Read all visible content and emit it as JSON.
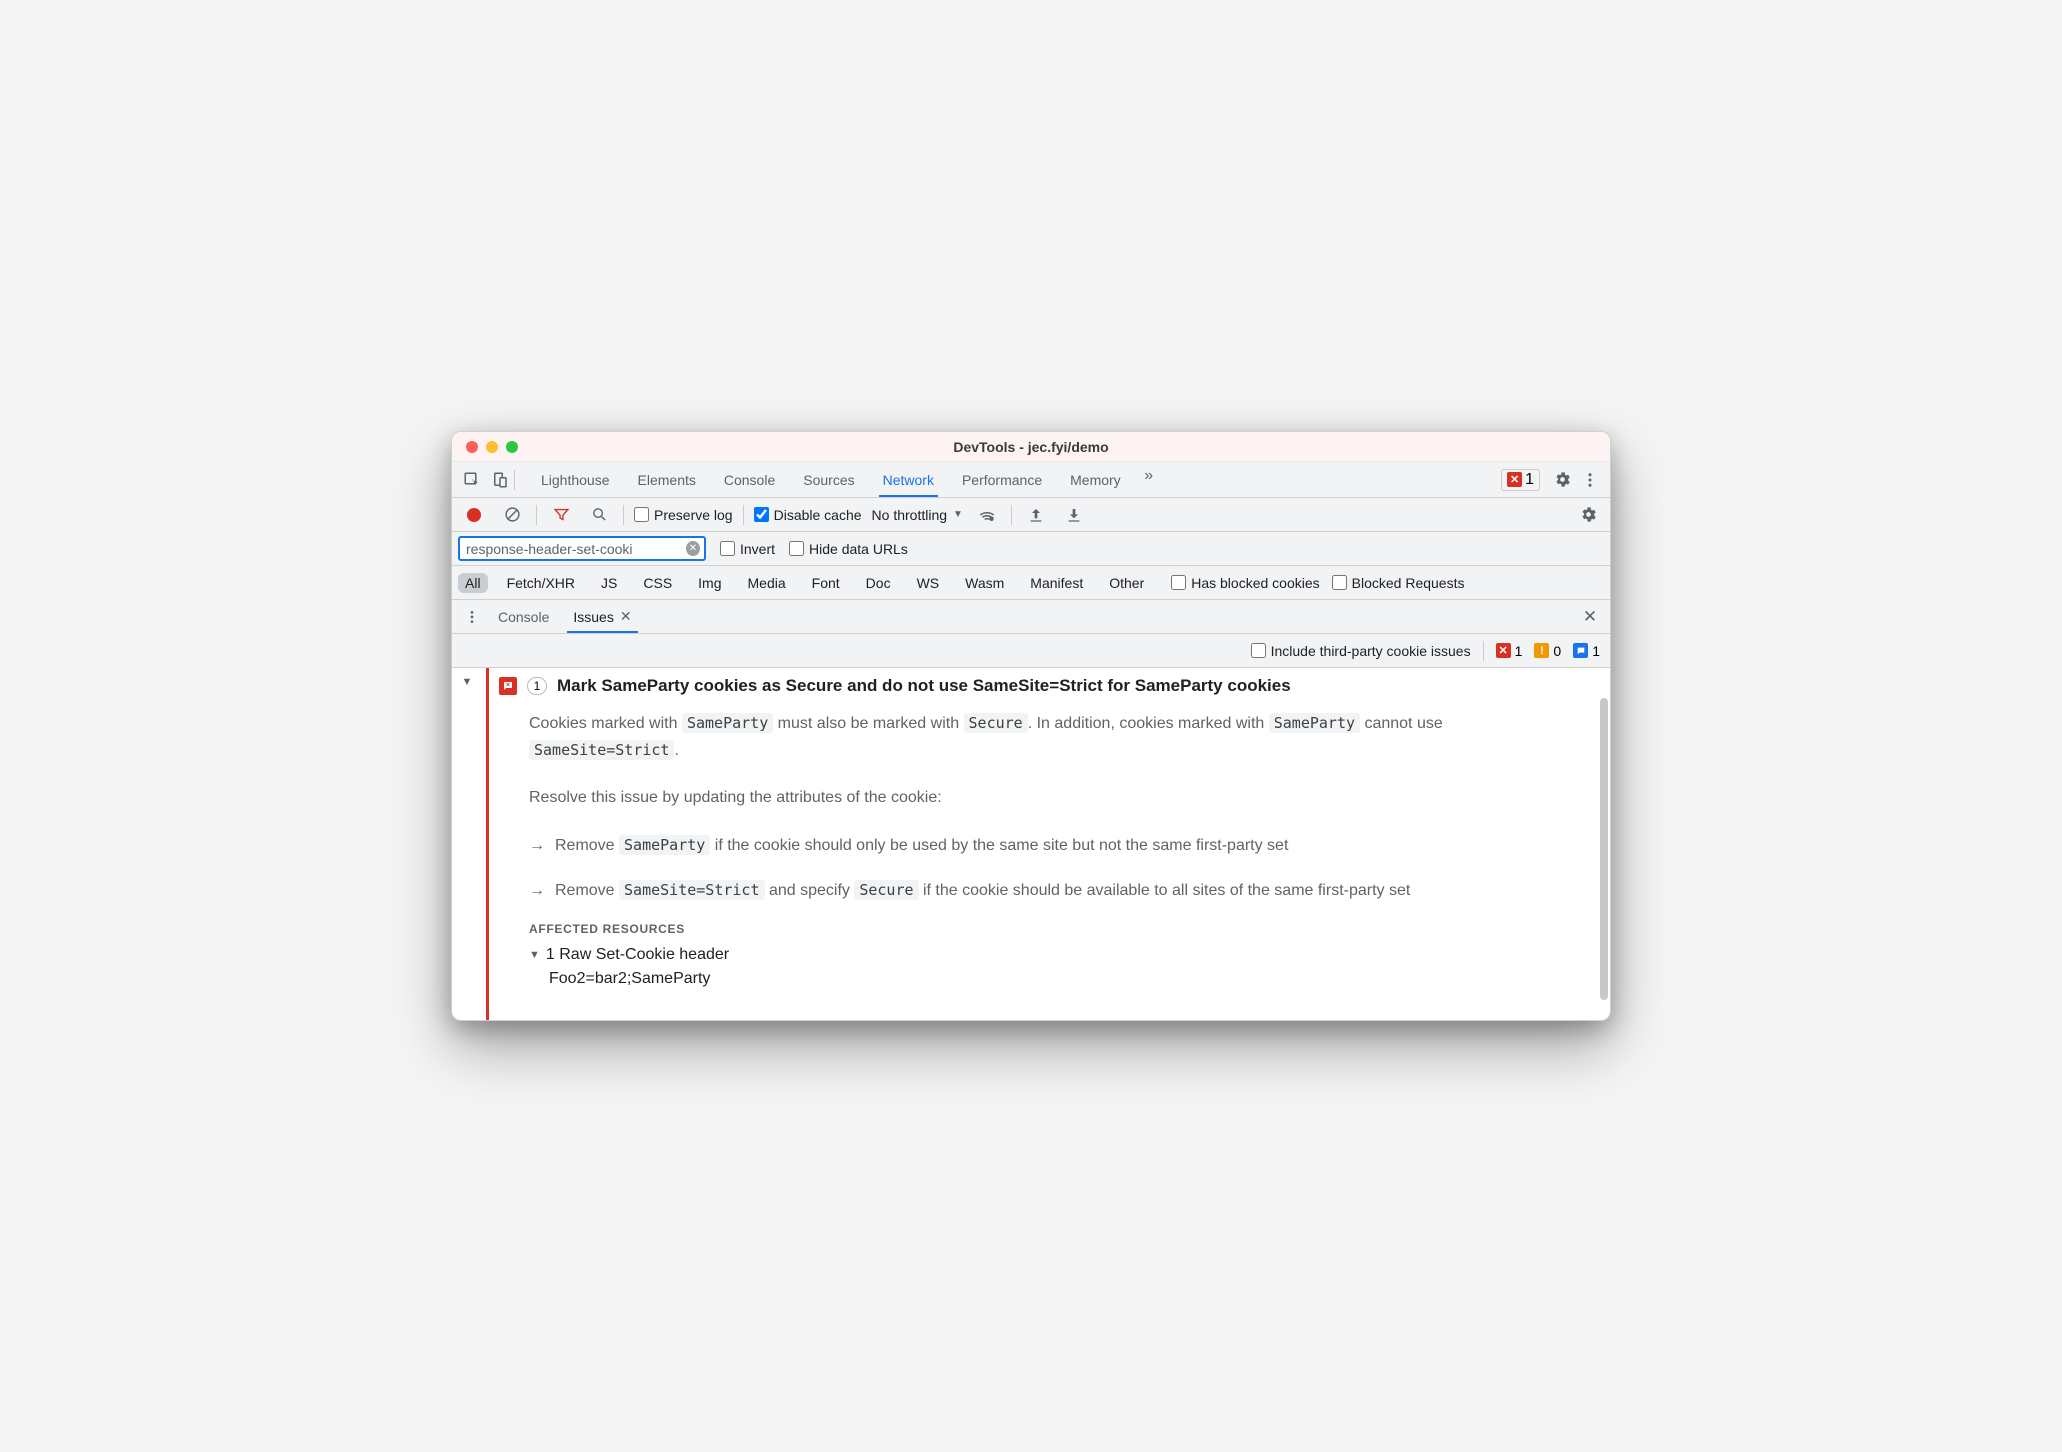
{
  "window": {
    "title": "DevTools - jec.fyi/demo"
  },
  "mainTabs": {
    "items": [
      "Lighthouse",
      "Elements",
      "Console",
      "Sources",
      "Network",
      "Performance",
      "Memory"
    ],
    "active": "Network",
    "errorCount": "1"
  },
  "networkBar": {
    "preserveLogLabel": "Preserve log",
    "disableCacheLabel": "Disable cache",
    "disableCacheChecked": true,
    "throttling": "No throttling"
  },
  "filterBar": {
    "filterValue": "response-header-set-cooki",
    "invertLabel": "Invert",
    "hideDataUrlsLabel": "Hide data URLs"
  },
  "typeFilters": {
    "items": [
      "All",
      "Fetch/XHR",
      "JS",
      "CSS",
      "Img",
      "Media",
      "Font",
      "Doc",
      "WS",
      "Wasm",
      "Manifest",
      "Other"
    ],
    "active": "All",
    "hasBlockedCookiesLabel": "Has blocked cookies",
    "blockedRequestsLabel": "Blocked Requests"
  },
  "drawer": {
    "tabs": [
      "Console",
      "Issues"
    ],
    "active": "Issues"
  },
  "issuesToolbar": {
    "includeThirdPartyLabel": "Include third-party cookie issues",
    "errorCount": "1",
    "warnCount": "0",
    "infoCount": "1"
  },
  "issue": {
    "count": "1",
    "title": "Mark SameParty cookies as Secure and do not use SameSite=Strict for SameParty cookies",
    "p1_a": "Cookies marked with ",
    "p1_c1": "SameParty",
    "p1_b": " must also be marked with ",
    "p1_c2": "Secure",
    "p1_c": ". In addition, cookies marked with ",
    "p1_c3": "SameParty",
    "p1_d": " cannot use ",
    "p1_c4": "SameSite=Strict",
    "p1_e": ".",
    "p2": "Resolve this issue by updating the attributes of the cookie:",
    "b1_a": "Remove ",
    "b1_c1": "SameParty",
    "b1_b": " if the cookie should only be used by the same site but not the same first-party set",
    "b2_a": "Remove ",
    "b2_c1": "SameSite=Strict",
    "b2_b": " and specify ",
    "b2_c2": "Secure",
    "b2_c": " if the cookie should be available to all sites of the same first-party set",
    "affectedHeading": "AFFECTED RESOURCES",
    "affectedItem": "1 Raw Set-Cookie header",
    "affectedValue": "Foo2=bar2;SameParty"
  }
}
